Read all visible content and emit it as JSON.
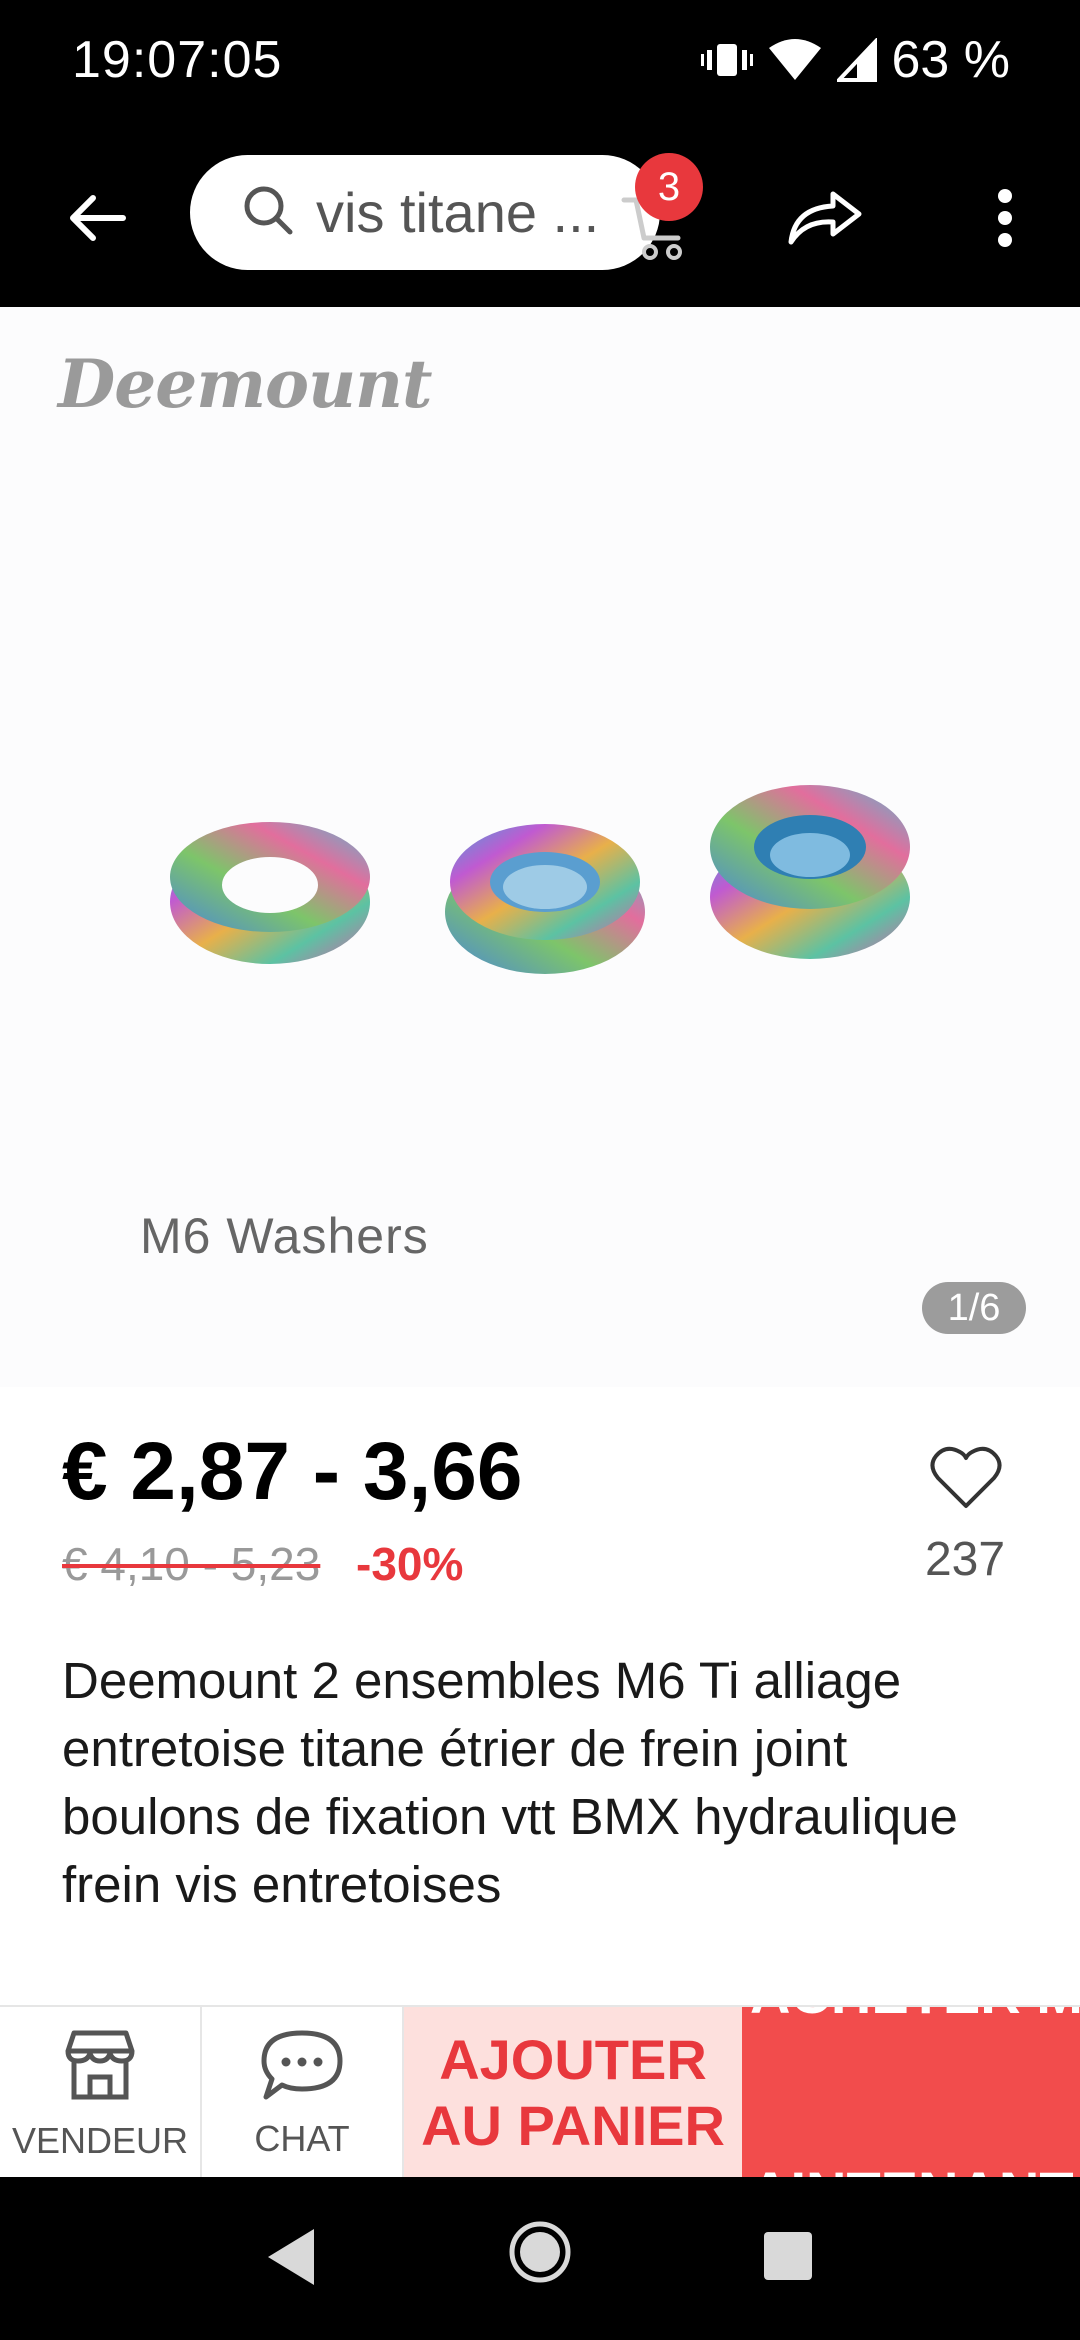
{
  "status_bar": {
    "time": "19:07:05",
    "battery": "63 %"
  },
  "app_bar": {
    "search_text": "vis titane ...",
    "cart_count": "3"
  },
  "product_image": {
    "brand_logo": "Deemount",
    "caption": "M6 Washers",
    "counter": "1/6"
  },
  "pricing": {
    "price": "€ 2,87 - 3,66",
    "old_price": "€ 4,10 - 5,23",
    "discount": "-30%",
    "wishlist_count": "237"
  },
  "product": {
    "title": "Deemount 2 ensembles M6 Ti alliage entretoise titane étrier de frein joint boulons de fixation vtt BMX hydraulique frein vis entretoises"
  },
  "actions": {
    "seller_label": "VENDEUR",
    "chat_label": "CHAT",
    "add_to_cart_line1": "AJOUTER",
    "add_to_cart_line2": "AU PANIER",
    "buy_now_line1": "ACHETER M",
    "buy_now_line2": "AINTENANT"
  },
  "colors": {
    "accent": "#e8383d",
    "buy_button": "#f24c4c",
    "add_cart_bg": "#fde0dd"
  },
  "icons": {
    "back": "arrow-left-icon",
    "search": "search-icon",
    "cart": "cart-icon",
    "share": "share-icon",
    "more": "more-vertical-icon",
    "wishlist": "heart-icon",
    "seller": "store-icon",
    "chat": "chat-bubble-icon"
  }
}
